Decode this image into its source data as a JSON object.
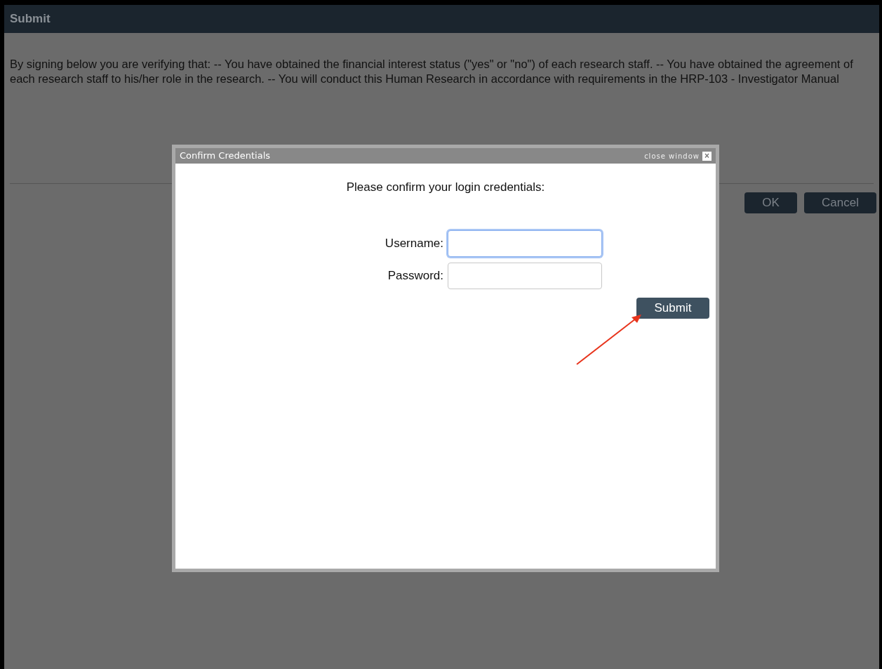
{
  "page": {
    "title": "Submit",
    "statement": "By signing below you are verifying that: -- You have obtained the financial interest status (\"yes\" or \"no\") of each research staff. -- You have obtained the agreement of each research staff to his/her role in the research. -- You will conduct this Human Research in accordance with requirements in the HRP-103 - Investigator Manual",
    "buttons": [
      "OK",
      "Cancel"
    ]
  },
  "dialog": {
    "title": "Confirm Credentials",
    "close_label": "close window",
    "close_glyph": "×",
    "prompt": "Please confirm your login credentials:",
    "fields": [
      {
        "label": "Username:",
        "focused": true
      },
      {
        "label": "Password:",
        "focused": false
      }
    ],
    "submit": "Submit"
  },
  "annotation": {
    "kind": "arrow"
  }
}
